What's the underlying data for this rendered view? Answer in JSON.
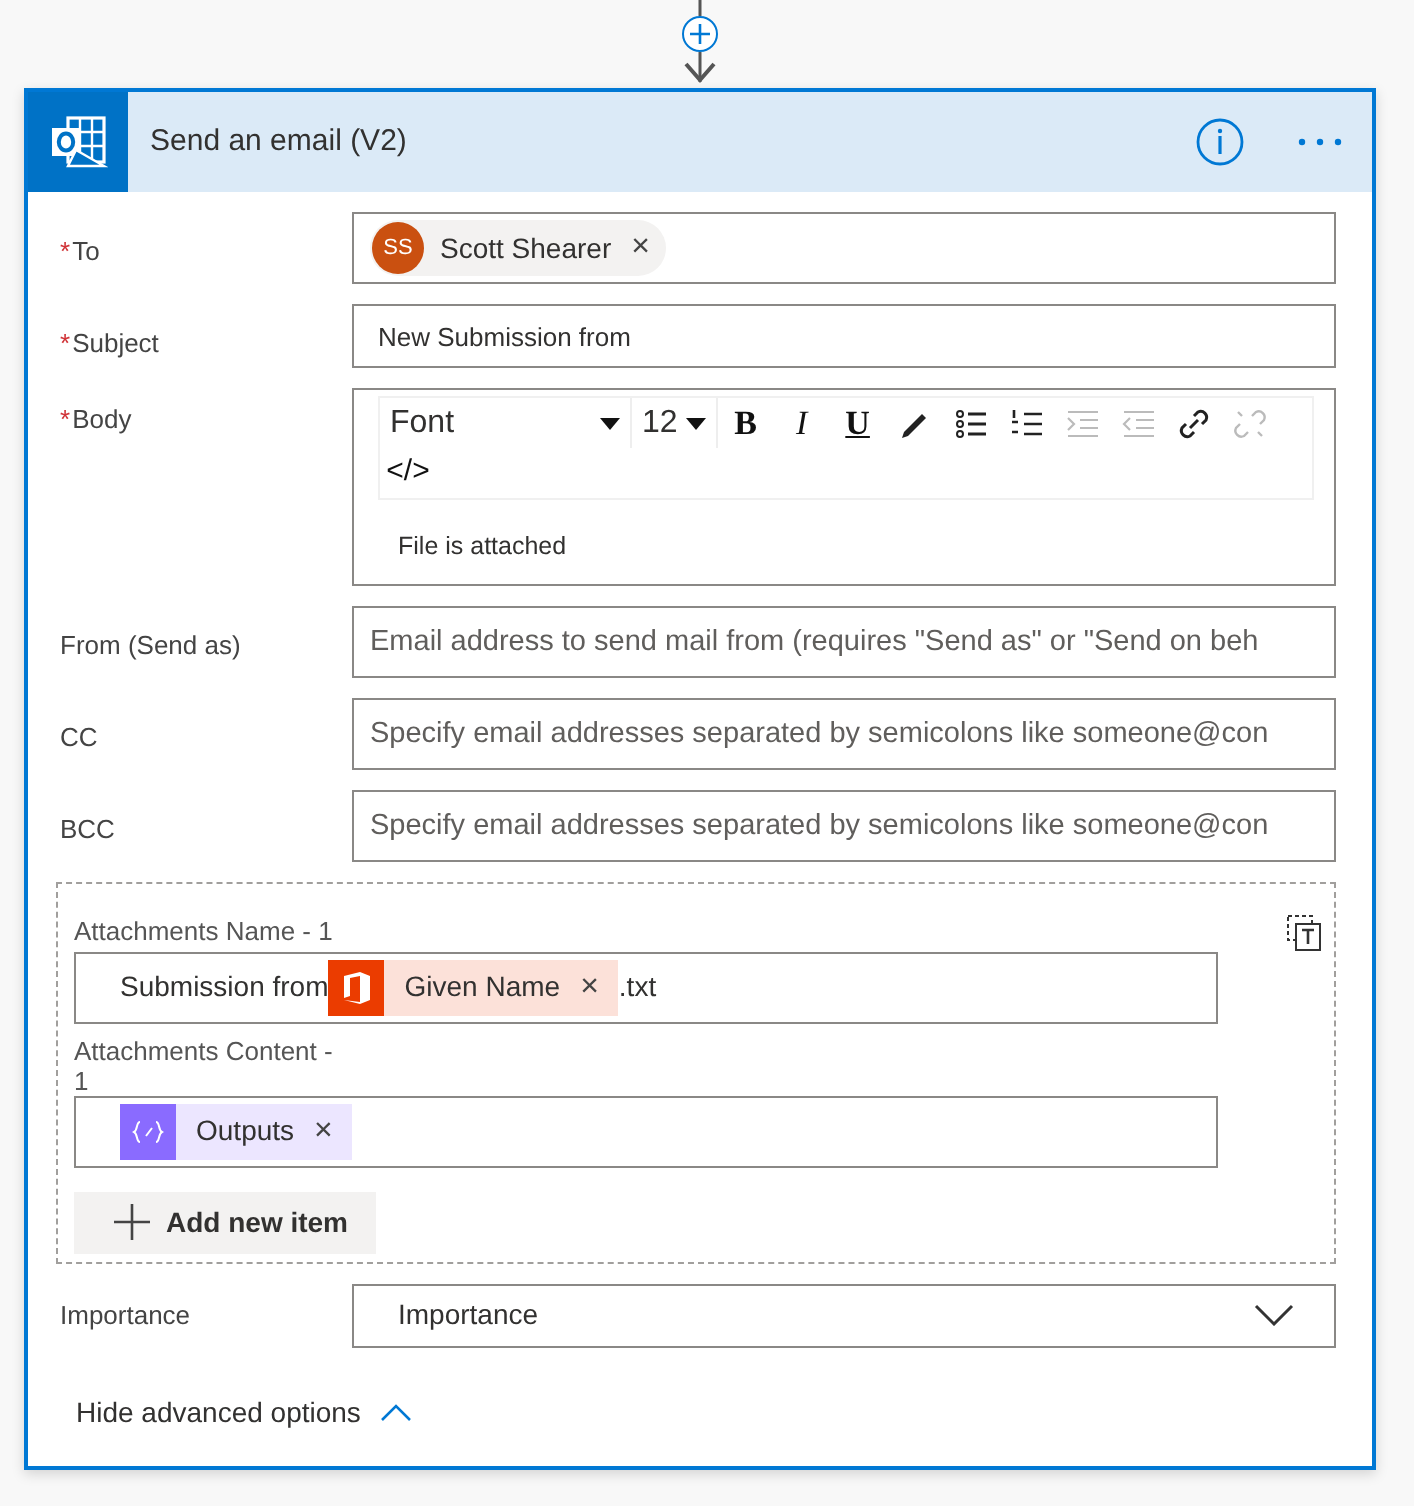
{
  "action": {
    "title": "Send an email (V2)"
  },
  "required_mark": "*",
  "fields": [
    {
      "kind": "recipients",
      "label": "To",
      "required": true,
      "tokens": [
        {
          "initials": "SS",
          "name": "Scott Shearer",
          "remove": "×"
        }
      ]
    },
    {
      "kind": "text",
      "label": "Subject",
      "required": true,
      "value": "New Submission from"
    },
    {
      "kind": "richtext",
      "label": "Body",
      "required": true,
      "toolbar": {
        "font": "Font",
        "size": "12",
        "buttons": [
          {
            "kind": "bold",
            "label": "B",
            "disabled": false
          },
          {
            "kind": "italic",
            "label": "I",
            "disabled": false
          },
          {
            "kind": "underline",
            "label": "U",
            "disabled": false
          },
          {
            "kind": "highlight",
            "disabled": false
          },
          {
            "kind": "bullets",
            "disabled": false
          },
          {
            "kind": "numbering",
            "disabled": false
          },
          {
            "kind": "indent",
            "disabled": true
          },
          {
            "kind": "outdent",
            "disabled": true
          },
          {
            "kind": "link",
            "disabled": false
          },
          {
            "kind": "unlink",
            "disabled": true
          }
        ],
        "code": "</>"
      },
      "value": "File is attached"
    },
    {
      "kind": "text",
      "label": "From (Send as)",
      "required": false,
      "placeholder": "Email address to send mail from (requires \"Send as\" or \"Send on beh"
    },
    {
      "kind": "text",
      "label": "CC",
      "required": false,
      "placeholder": "Specify email addresses separated by semicolons like someone@con"
    },
    {
      "kind": "text",
      "label": "BCC",
      "required": false,
      "placeholder": "Specify email addresses separated by semicolons like someone@con"
    }
  ],
  "attachments": {
    "items": [
      {
        "label": "Attachments Name - 1",
        "parts": [
          {
            "kind": "text",
            "text": "Submission from"
          },
          {
            "kind": "office",
            "label": "Given Name",
            "remove": "×"
          },
          {
            "kind": "text",
            "text": ".txt"
          }
        ]
      },
      {
        "label": "Attachments Content - 1",
        "parts": [
          {
            "kind": "expression",
            "label": "Outputs",
            "remove": "×"
          }
        ]
      }
    ],
    "add_button": "Add new item"
  },
  "importance": {
    "label": "Importance",
    "value": "Importance"
  },
  "advanced_toggle": {
    "label": "Hide advanced options",
    "expanded": true
  }
}
